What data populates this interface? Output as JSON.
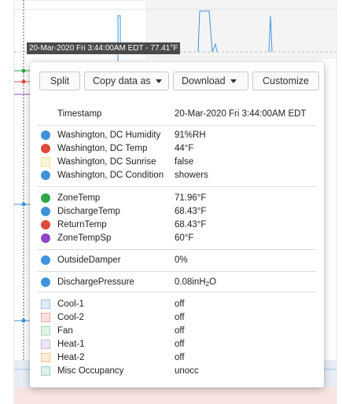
{
  "crosshair": {
    "label": "20-Mar-2020 Fri 3:44:00AM EDT - 77.41°F"
  },
  "toolbar": {
    "split": "Split",
    "copy": "Copy data as",
    "download": "Download",
    "customize": "Customize"
  },
  "timestamp": {
    "label": "Timestamp",
    "value": "20-Mar-2020 Fri 3:44:00AM EDT"
  },
  "groups": {
    "weather": [
      {
        "label": "Washington, DC Humidity",
        "value": "91%RH",
        "color": "#3f93dc",
        "shape": "dot"
      },
      {
        "label": "Washington, DC Temp",
        "value": "44°F",
        "color": "#e04a3c",
        "shape": "dot"
      },
      {
        "label": "Washington, DC Sunrise",
        "value": "false",
        "color": "#f6df8e",
        "shape": "square"
      },
      {
        "label": "Washington, DC Condition",
        "value": "showers",
        "color": "#3f93dc",
        "shape": "dot"
      }
    ],
    "zone": [
      {
        "label": "ZoneTemp",
        "value": "71.96°F",
        "color": "#2fa54a",
        "shape": "dot"
      },
      {
        "label": "DischargeTemp",
        "value": "68.43°F",
        "color": "#3f93dc",
        "shape": "dot"
      },
      {
        "label": "ReturnTemp",
        "value": "68.43°F",
        "color": "#e04a3c",
        "shape": "dot"
      },
      {
        "label": "ZoneTempSp",
        "value": "60°F",
        "color": "#8e44c4",
        "shape": "dot"
      }
    ],
    "damper": [
      {
        "label": "OutsideDamper",
        "value": "0%",
        "color": "#3f93dc",
        "shape": "dot"
      }
    ],
    "pressure": {
      "label": "DischargePressure",
      "value_prefix": "0.08inH",
      "value_sub": "2",
      "value_suffix": "O",
      "color": "#3f93dc",
      "shape": "dot"
    },
    "status": [
      {
        "label": "Cool-1",
        "value": "off",
        "color": "#9fc6ec",
        "shape": "square"
      },
      {
        "label": "Cool-2",
        "value": "off",
        "color": "#f0a9a3",
        "shape": "square"
      },
      {
        "label": "Fan",
        "value": "off",
        "color": "#a6dcb0",
        "shape": "square"
      },
      {
        "label": "Heat-1",
        "value": "off",
        "color": "#cdb4e4",
        "shape": "square"
      },
      {
        "label": "Heat-2",
        "value": "off",
        "color": "#f7c98a",
        "shape": "square"
      },
      {
        "label": "Misc Occupancy",
        "value": "unocc",
        "color": "#9fd3c4",
        "shape": "square"
      }
    ]
  }
}
